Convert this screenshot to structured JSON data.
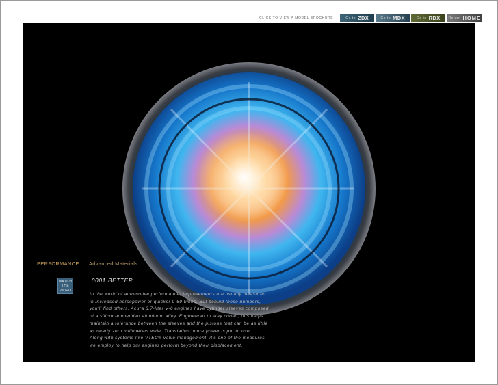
{
  "nav": {
    "brochure_label": "CLICK TO VIEW A MODEL BROCHURE",
    "buttons": [
      {
        "prefix": "Go to",
        "label": "ZDX"
      },
      {
        "prefix": "Go to",
        "label": "MDX"
      },
      {
        "prefix": "Go to",
        "label": "RDX"
      },
      {
        "prefix": "Return",
        "label": "HOME"
      }
    ]
  },
  "section": {
    "category": "PERFORMANCE",
    "title": "Advanced Materials"
  },
  "video": {
    "line1": "WATCH",
    "line2": "THE",
    "line3": "VIDEO"
  },
  "content": {
    "headline": ".0001 BETTER.",
    "body_lines": [
      "In the world of automotive performance, improvements are usually measured",
      "in increased horsepower or quicker 0-60 times. But behind those numbers,",
      "you'll find others. Acura 3.7-liter V-6 engines have cylinder sleeves composed",
      "of a silicon-embedded aluminum alloy. Engineered to stay cooler, this helps",
      "maintain a tolerance between the sleeves and the pistons that can be as little",
      "as nearly zero millimeters wide. Translation: more power is put to use.",
      "Along with systems like VTEC® valve management, it's one of the measures",
      "we employ to help our engines perform beyond their displacement."
    ]
  },
  "colors": {
    "panel": "#000000",
    "accent_gold": "#c8a05a",
    "video_button": "#3a5f7a"
  },
  "image": {
    "subject": "microscopic-alloy-sphere"
  }
}
